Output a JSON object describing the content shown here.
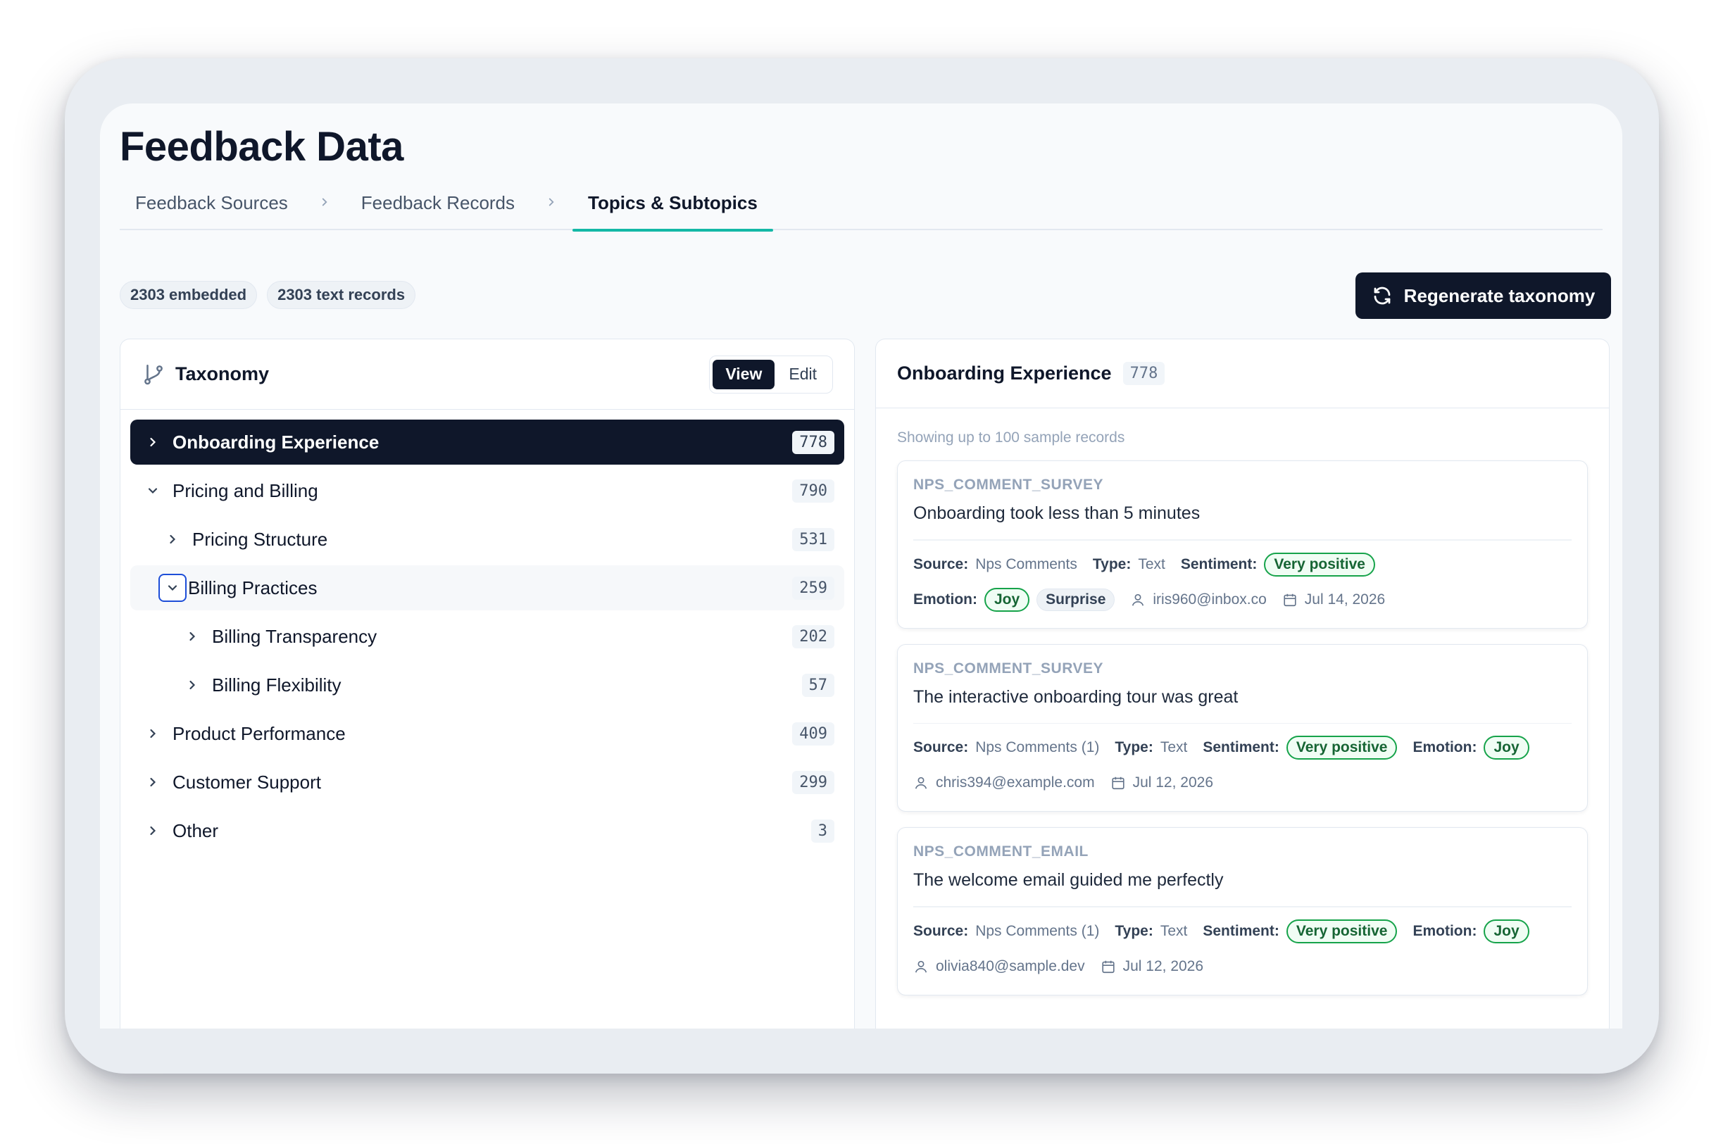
{
  "page": {
    "title": "Feedback Data"
  },
  "tabs": [
    {
      "label": "Feedback Sources"
    },
    {
      "label": "Feedback Records"
    },
    {
      "label": "Topics & Subtopics"
    }
  ],
  "stats": {
    "embedded": "2303 embedded",
    "text_records": "2303 text records"
  },
  "actions": {
    "regenerate_label": "Regenerate taxonomy"
  },
  "taxonomy": {
    "title": "Taxonomy",
    "view_label": "View",
    "edit_label": "Edit",
    "nodes": [
      {
        "label": "Onboarding Experience",
        "count": "778"
      },
      {
        "label": "Pricing and Billing",
        "count": "790"
      },
      {
        "label": "Pricing Structure",
        "count": "531"
      },
      {
        "label": "Billing Practices",
        "count": "259"
      },
      {
        "label": "Billing Transparency",
        "count": "202"
      },
      {
        "label": "Billing Flexibility",
        "count": "57"
      },
      {
        "label": "Product Performance",
        "count": "409"
      },
      {
        "label": "Customer Support",
        "count": "299"
      },
      {
        "label": "Other",
        "count": "3"
      }
    ]
  },
  "detail": {
    "title": "Onboarding Experience",
    "count": "778",
    "showing": "Showing up to 100 sample records",
    "labels": {
      "source": "Source:",
      "type": "Type:",
      "sentiment": "Sentiment:",
      "emotion": "Emotion:"
    },
    "records": [
      {
        "source_type": "NPS_COMMENT_SURVEY",
        "text": "Onboarding took less than 5 minutes",
        "source": "Nps Comments",
        "type": "Text",
        "sentiment": "Very positive",
        "emotion": "Joy",
        "emotion2": "Surprise",
        "user": "iris960@inbox.co",
        "date": "Jul 14, 2026"
      },
      {
        "source_type": "NPS_COMMENT_SURVEY",
        "text": "The interactive onboarding tour was great",
        "source": "Nps Comments (1)",
        "type": "Text",
        "sentiment": "Very positive",
        "emotion": "Joy",
        "user": "chris394@example.com",
        "date": "Jul 12, 2026"
      },
      {
        "source_type": "NPS_COMMENT_EMAIL",
        "text": "The welcome email guided me perfectly",
        "source": "Nps Comments (1)",
        "type": "Text",
        "sentiment": "Very positive",
        "emotion": "Joy",
        "user": "olivia840@sample.dev",
        "date": "Jul 12, 2026"
      }
    ]
  },
  "colors": {
    "primary": "#0f172a",
    "accent": "#14b8a6",
    "positive": "#16a34a",
    "focus": "#1d4ed8"
  }
}
